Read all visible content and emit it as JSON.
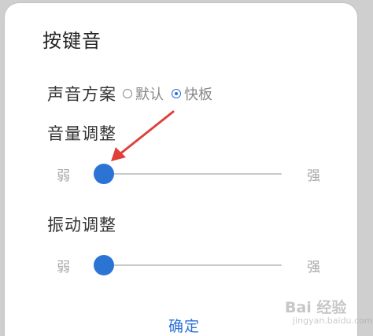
{
  "dialog": {
    "title": "按键音",
    "sound_scheme": {
      "label": "声音方案",
      "options": [
        {
          "label": "默认",
          "selected": false
        },
        {
          "label": "快板",
          "selected": true
        }
      ]
    },
    "volume": {
      "label": "音量调整",
      "min_label": "弱",
      "max_label": "强",
      "level": 0.03
    },
    "vibration": {
      "label": "振动调整",
      "min_label": "弱",
      "max_label": "强",
      "level": 0.03
    },
    "confirm_label": "确定"
  },
  "colors": {
    "accent": "#2c74d4",
    "annotation_arrow": "#e0403a"
  },
  "watermark": {
    "brand": "Bai 经验",
    "site": "jingyan.baidu.com"
  }
}
